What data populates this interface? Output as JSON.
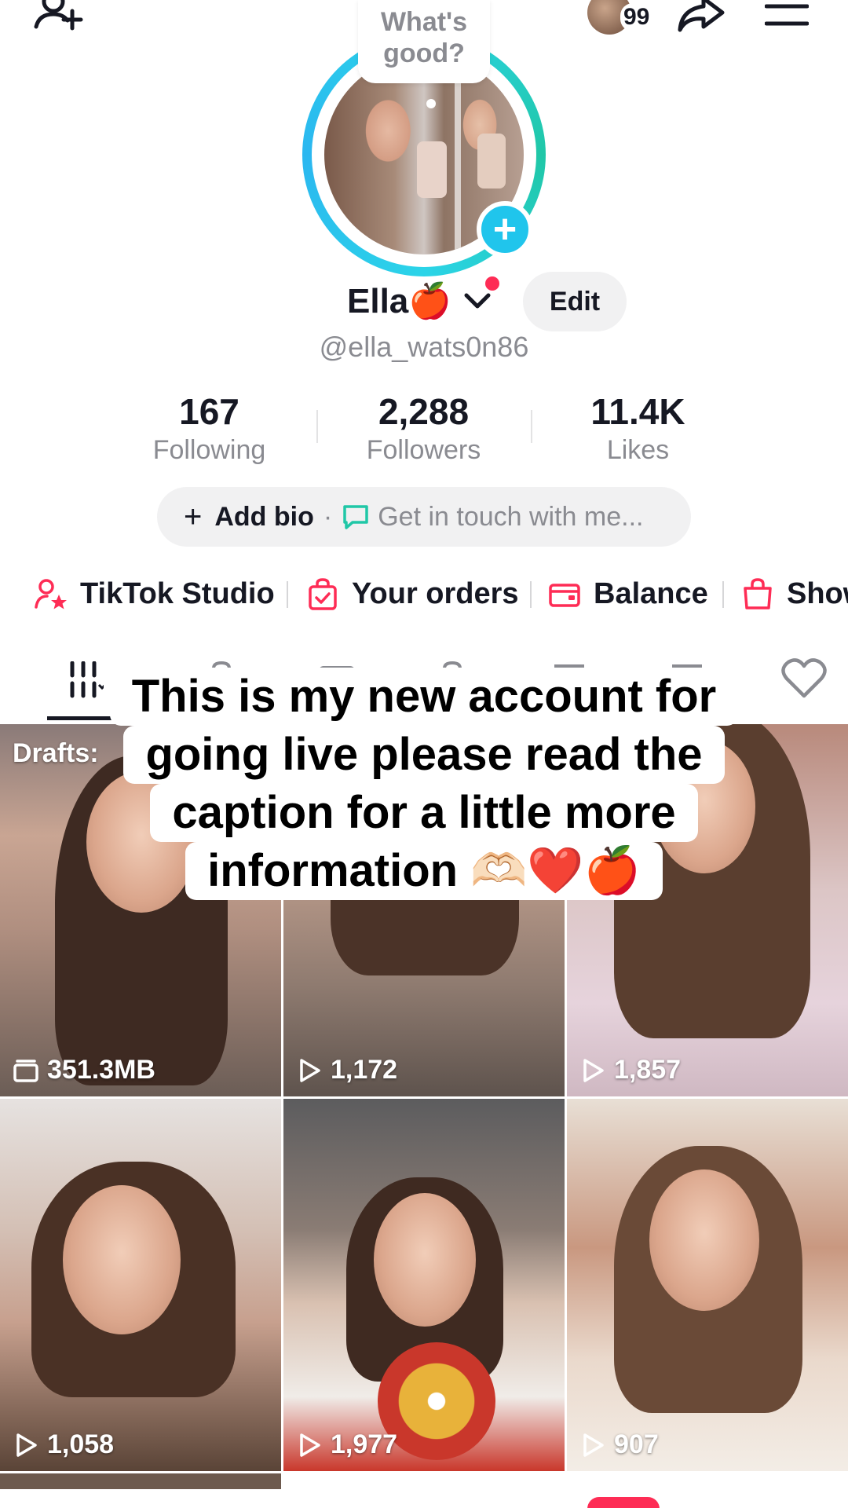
{
  "header": {
    "notification_count": "99",
    "speech_bubble": "What's good?"
  },
  "profile": {
    "display_name": "Ella",
    "name_emoji": "🍎",
    "edit_label": "Edit",
    "username": "@ella_wats0n86"
  },
  "stats": [
    {
      "value": "167",
      "label": "Following"
    },
    {
      "value": "2,288",
      "label": "Followers"
    },
    {
      "value": "11.4K",
      "label": "Likes"
    }
  ],
  "bio": {
    "add_label": "Add bio",
    "separator": "·",
    "contact_label": "Get in touch with me..."
  },
  "shortcuts": [
    {
      "label": "TikTok Studio",
      "icon": "person-star-icon"
    },
    {
      "label": "Your orders",
      "icon": "bag-check-icon"
    },
    {
      "label": "Balance",
      "icon": "wallet-icon"
    },
    {
      "label": "Show",
      "icon": "shopping-bag-icon"
    }
  ],
  "caption": {
    "lines": [
      "This is my new account for",
      "going live please read the",
      "caption for a little more",
      "information 🫶🏻❤️🍎"
    ]
  },
  "grid": {
    "drafts_label": "Drafts:",
    "tiles": [
      {
        "stat": "351.3MB",
        "icon": "drafts-icon"
      },
      {
        "stat": "1,172",
        "icon": "play-icon"
      },
      {
        "stat": "1,857",
        "icon": "play-icon"
      },
      {
        "stat": "1,058",
        "icon": "play-icon"
      },
      {
        "stat": "1,977",
        "icon": "play-icon"
      },
      {
        "stat": "907",
        "icon": "play-icon"
      }
    ]
  },
  "colors": {
    "accent_red": "#fe2c55",
    "ring_cyan": "#20c5ec",
    "text_primary": "#161823",
    "text_secondary": "#8a8b91"
  }
}
